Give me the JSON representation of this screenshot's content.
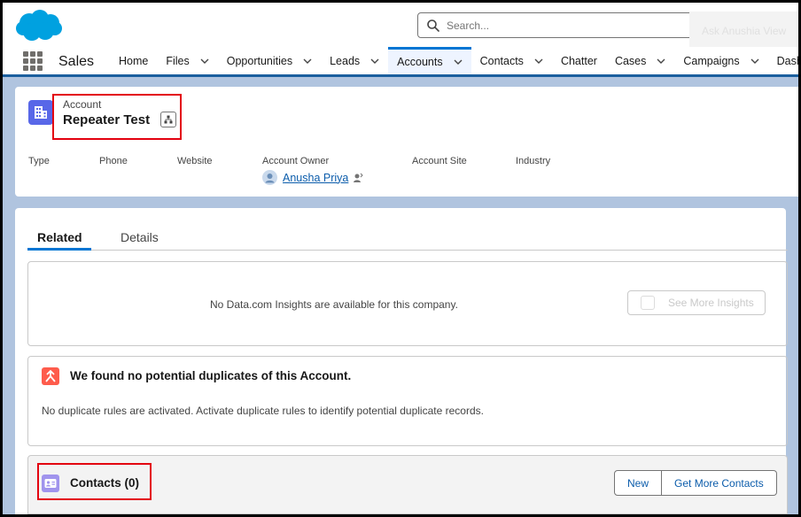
{
  "header": {
    "search_placeholder": "Search...",
    "ghost_text": "Ask Anushia View"
  },
  "nav": {
    "app_name": "Sales",
    "items": [
      {
        "label": "Home",
        "has_menu": false
      },
      {
        "label": "Files",
        "has_menu": true
      },
      {
        "label": "Opportunities",
        "has_menu": true
      },
      {
        "label": "Leads",
        "has_menu": true
      },
      {
        "label": "Accounts",
        "has_menu": true,
        "active": true
      },
      {
        "label": "Contacts",
        "has_menu": true
      },
      {
        "label": "Chatter",
        "has_menu": false
      },
      {
        "label": "Cases",
        "has_menu": true
      },
      {
        "label": "Campaigns",
        "has_menu": true
      },
      {
        "label": "Dashbo",
        "has_menu": false
      }
    ]
  },
  "record": {
    "object_type": "Account",
    "name": "Repeater Test",
    "fields": {
      "type": "Type",
      "phone": "Phone",
      "website": "Website",
      "account_owner": "Account Owner",
      "account_site": "Account Site",
      "industry": "Industry"
    },
    "owner_name": "Anusha Priya"
  },
  "tabs": {
    "related": "Related",
    "details": "Details"
  },
  "insights": {
    "message": "No Data.com Insights are available for this company.",
    "button_label": "See More Insights"
  },
  "duplicates": {
    "title": "We found no potential duplicates of this Account.",
    "message": "No duplicate rules are activated. Activate duplicate rules to identify potential duplicate records."
  },
  "contacts": {
    "title": "Contacts (0)",
    "new_label": "New",
    "more_label": "Get More Contacts"
  },
  "colors": {
    "brand_blue": "#0176d3",
    "link_blue": "#0b5cab",
    "account_icon": "#5867e8",
    "duplicate_icon": "#fe5c4c",
    "contacts_icon": "#a094ed",
    "annotation_red": "#e3000f"
  }
}
